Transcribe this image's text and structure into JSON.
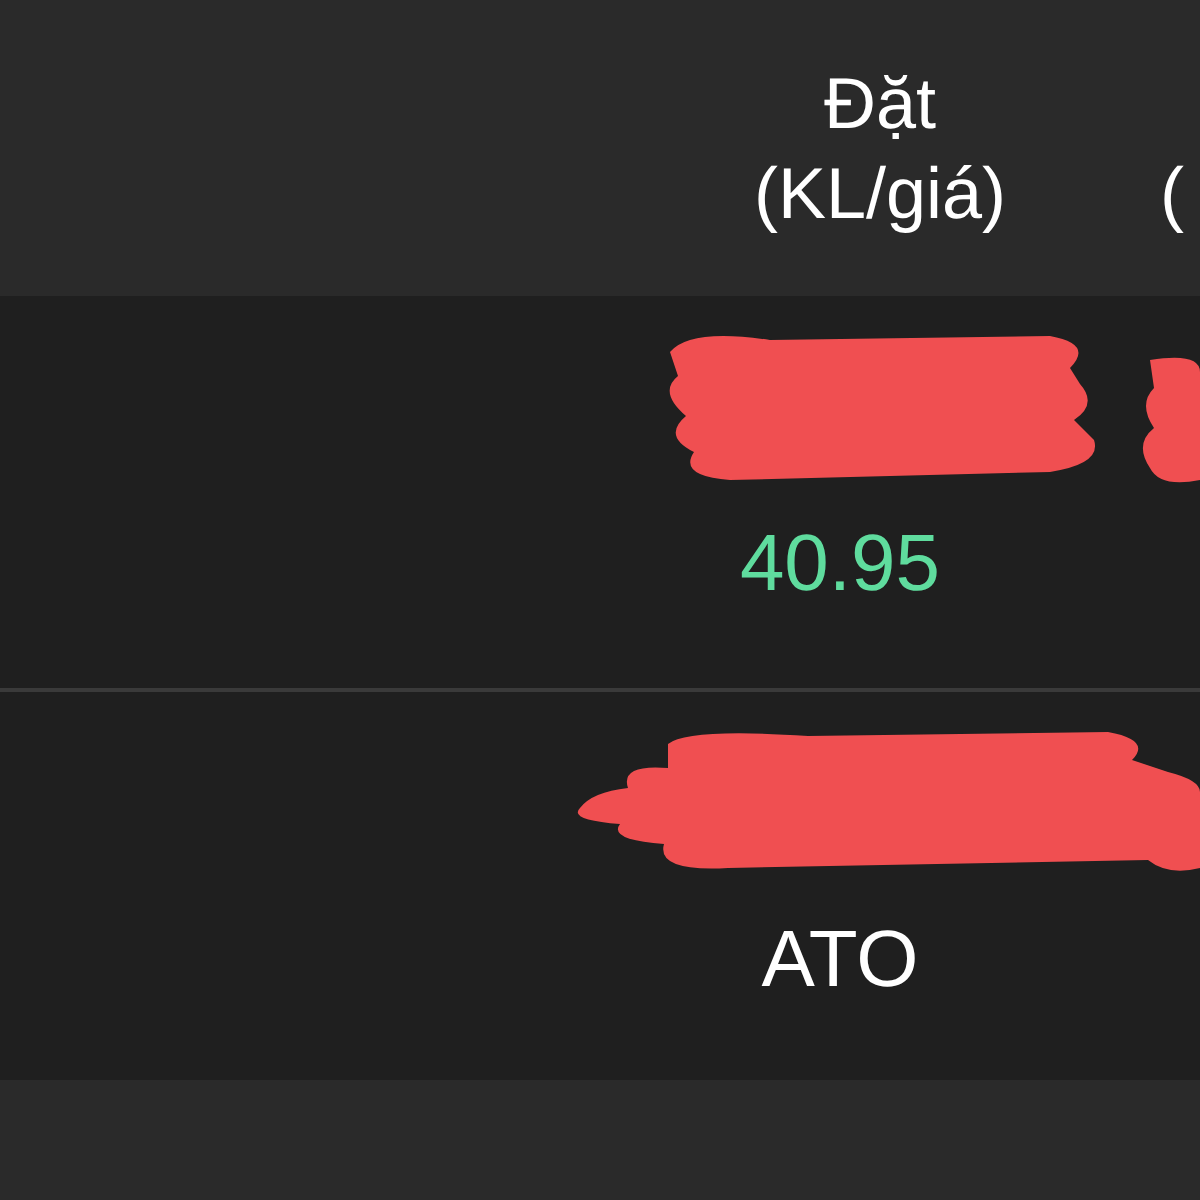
{
  "header": {
    "columns": [
      {
        "lines": [
          "Đặt",
          "(KL/giá)"
        ]
      },
      {
        "lines": [
          "("
        ]
      }
    ]
  },
  "rows": [
    {
      "price": "40.95",
      "color": "#5fdc9e"
    },
    {
      "price": "ATO",
      "color": "#ffffff"
    }
  ]
}
